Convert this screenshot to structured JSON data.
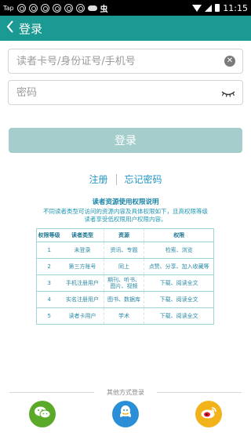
{
  "statusbar": {
    "carrier": "Tap",
    "extra": "虫",
    "time": "11:15"
  },
  "header": {
    "back_icon": "chevron-left-icon",
    "title": "登录"
  },
  "form": {
    "account_placeholder": "读者卡号/身份证号/手机号",
    "password_placeholder": "密码",
    "login_label": "登录"
  },
  "links": {
    "register": "注册",
    "forgot": "忘记密码"
  },
  "notice": {
    "title": "读者资源使用权限说明",
    "line1": "不同读者类型可访问的资源内容及具体权限如下，且高权限等级",
    "line2": "读者享受低权限用户权限内容。"
  },
  "table": {
    "headers": [
      "权限等级",
      "读者类型",
      "资源",
      "权限"
    ],
    "rows": [
      {
        "level": "1",
        "type": "未登录",
        "res": "资讯、专题",
        "perm": "检索、浏览"
      },
      {
        "level": "2",
        "type": "第三方账号",
        "res": "同上",
        "perm": "点赞、分享、加入收藏等"
      },
      {
        "level": "3",
        "type": "手机注册用户",
        "res": "期刊、听书、图片、视频",
        "perm": "下载、阅读全文"
      },
      {
        "level": "4",
        "type": "实名注册用户",
        "res": "图书、数据库",
        "perm": "下载、阅读全文"
      },
      {
        "level": "5",
        "type": "读者卡用户",
        "res": "学术",
        "perm": "下载、阅读全文"
      }
    ]
  },
  "footer": {
    "other_login": "其他方式登录",
    "providers": [
      "wechat-icon",
      "qq-icon",
      "weibo-icon"
    ],
    "colors": {
      "wechat": "#5aa928",
      "qq": "#2a8fd6",
      "weibo": "#f2b21a"
    }
  },
  "theme": {
    "accent": "#1a9a92",
    "button_disabled": "#a4cdcb",
    "link": "#2096c8"
  }
}
